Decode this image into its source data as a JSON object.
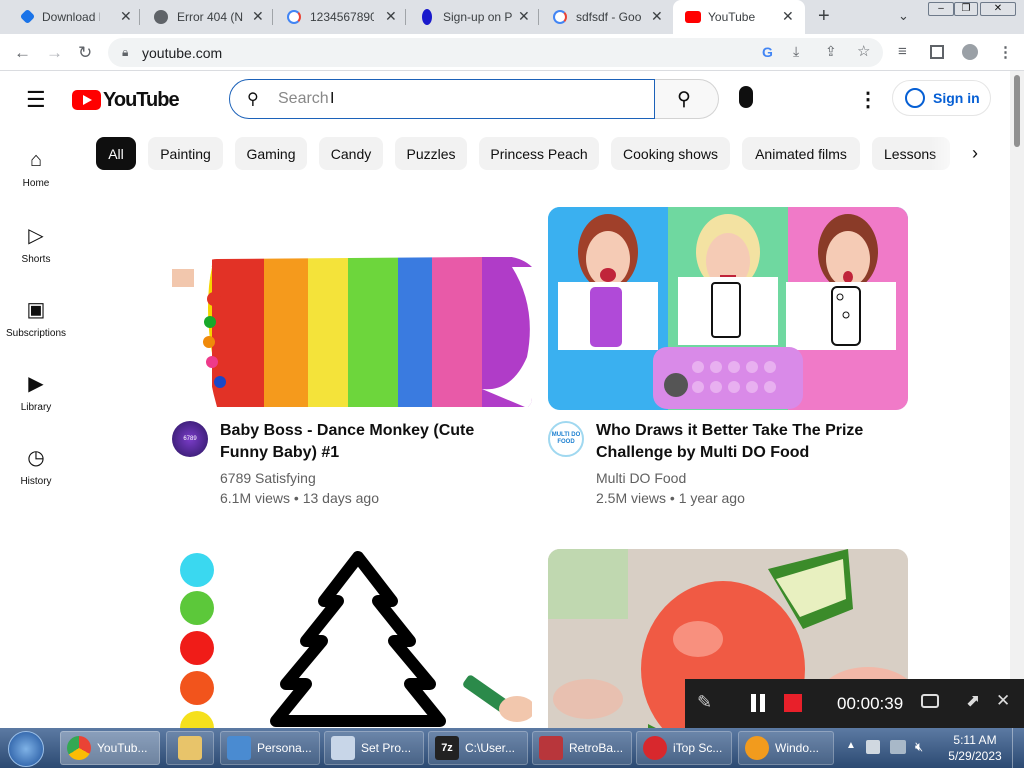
{
  "browser": {
    "tabs": [
      {
        "label": "Download Dr",
        "icon": "shield-icon",
        "color": "#1a73e8"
      },
      {
        "label": "Error 404 (N",
        "icon": "globe-icon",
        "color": "#5f6368"
      },
      {
        "label": "1234567890",
        "icon": "google-icon",
        "color": "#4285f4"
      },
      {
        "label": "Sign-up on P",
        "icon": "person-icon",
        "color": "#1a1acc"
      },
      {
        "label": "sdfsdf - Goo",
        "icon": "google-icon",
        "color": "#4285f4"
      },
      {
        "label": "YouTube",
        "icon": "youtube-icon",
        "color": "#ff0000"
      }
    ],
    "url": "youtube.com"
  },
  "youtube": {
    "logo_text": "YouTube",
    "search_placeholder": "Search",
    "sign_in": "Sign in",
    "chips": [
      "All",
      "Painting",
      "Gaming",
      "Candy",
      "Puzzles",
      "Princess Peach",
      "Cooking shows",
      "Animated films",
      "Lessons"
    ],
    "sidebar": [
      {
        "label": "Home",
        "icon": "home-icon"
      },
      {
        "label": "Shorts",
        "icon": "shorts-icon"
      },
      {
        "label": "Subscriptions",
        "icon": "subscriptions-icon"
      },
      {
        "label": "Library",
        "icon": "library-icon"
      },
      {
        "label": "History",
        "icon": "history-icon"
      }
    ],
    "videos": [
      {
        "title": "Baby Boss - Dance Monkey (Cute Funny Baby) #1",
        "channel": "6789 Satisfying",
        "meta": "6.1M views • 13 days ago",
        "avatar_text": "6789"
      },
      {
        "title": "Who Draws it Better Take The Prize Challenge by Multi DO Food",
        "channel": "Multi DO Food",
        "meta": "2.5M views • 1 year ago",
        "avatar_text": "MULTI DO FOOD"
      }
    ]
  },
  "recorder": {
    "time": "00:00:39"
  },
  "taskbar": {
    "items": [
      {
        "label": "YouTub...",
        "color": "#ea4335"
      },
      {
        "label": "",
        "color": "#e8c46a"
      },
      {
        "label": "Persona...",
        "color": "#4a8bd1"
      },
      {
        "label": "Set Pro...",
        "color": "#c8d6e8"
      },
      {
        "label": "C:\\User...",
        "color": "#222"
      },
      {
        "label": "RetroBa...",
        "color": "#b8363b"
      },
      {
        "label": "iTop Sc...",
        "color": "#d8282d"
      },
      {
        "label": "Windo...",
        "color": "#f29b1d"
      }
    ],
    "time": "5:11 AM",
    "date": "5/29/2023"
  }
}
